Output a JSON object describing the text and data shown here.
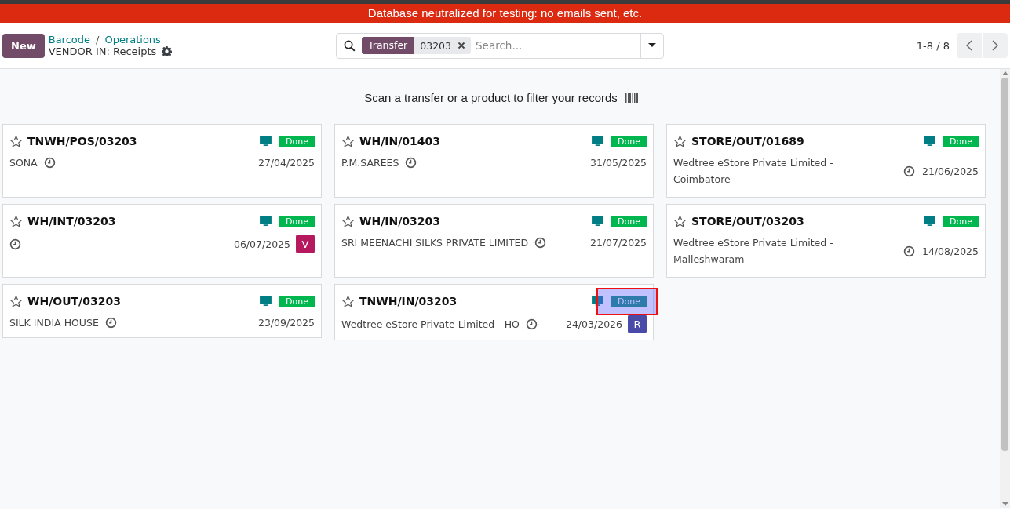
{
  "banner": "Database neutralized for testing: no emails sent, etc.",
  "control_panel": {
    "new_button": "New",
    "breadcrumbs": [
      "Barcode",
      "Operations"
    ],
    "breadcrumb_separator": "/",
    "title": "VENDOR IN: Receipts",
    "search": {
      "facet_label": "Transfer",
      "facet_value": "03203",
      "placeholder": "Search..."
    },
    "pager": "1-8 / 8"
  },
  "scan_hint": "Scan a transfer or a product to filter your records",
  "cards": [
    {
      "kind": "inline",
      "name": "TNWH/POS/03203",
      "status": "Done",
      "partner": "SONA",
      "date": "27/04/2025",
      "highlighted": false
    },
    {
      "kind": "inline",
      "name": "WH/IN/01403",
      "status": "Done",
      "partner": "P.M.SAREES",
      "date": "31/05/2025",
      "highlighted": false
    },
    {
      "kind": "stacked",
      "name": "STORE/OUT/01689",
      "status": "Done",
      "partner": "Wedtree eStore Private Limited - Coimbatore",
      "date": "21/06/2025",
      "highlighted": false
    },
    {
      "kind": "inline",
      "name": "WH/INT/03203",
      "status": "Done",
      "date": "06/07/2025",
      "avatar": {
        "letter": "V",
        "color": "#b5195e"
      },
      "highlighted": false
    },
    {
      "kind": "inline",
      "name": "WH/IN/03203",
      "status": "Done",
      "partner": "SRI MEENACHI SILKS PRIVATE LIMITED",
      "date": "21/07/2025",
      "highlighted": false
    },
    {
      "kind": "stacked",
      "name": "STORE/OUT/03203",
      "status": "Done",
      "partner": "Wedtree eStore Private Limited - Malleshwaram",
      "date": "14/08/2025",
      "highlighted": false
    },
    {
      "kind": "inline",
      "name": "WH/OUT/03203",
      "status": "Done",
      "partner": "SILK INDIA HOUSE",
      "date": "23/09/2025",
      "highlighted": false
    },
    {
      "kind": "inline",
      "name": "TNWH/IN/03203",
      "status": "Done",
      "partner": "Wedtree eStore Private Limited - HO",
      "date": "24/03/2026",
      "avatar": {
        "letter": "R",
        "color": "#4a4aa8"
      },
      "highlighted": true
    }
  ]
}
